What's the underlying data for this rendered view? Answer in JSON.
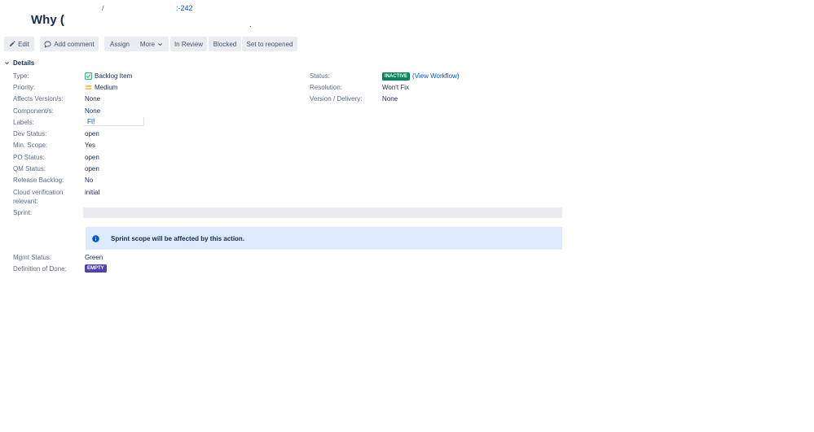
{
  "breadcrumb": {
    "separator": "/",
    "issue_key": ":-242"
  },
  "issue": {
    "title": "Why (",
    "title_tail": "."
  },
  "toolbar": {
    "edit": "Edit",
    "add_comment": "Add comment",
    "assign": "Assign",
    "more": "More",
    "in_review": "In Review",
    "blocked": "Blocked",
    "set_to_reopened": "Set to reopened"
  },
  "details": {
    "heading": "Details",
    "left": {
      "type": {
        "label": "Type:",
        "value": "Backlog Item"
      },
      "priority": {
        "label": "Priority:",
        "value": "Medium"
      },
      "affects_version": {
        "label": "Affects Version/s:",
        "value": "None"
      },
      "components": {
        "label": "Component/s:",
        "value": "None"
      },
      "labels": {
        "label": "Labels:",
        "value": "FI",
        "cursor": "!"
      },
      "dev_status": {
        "label": "Dev Status:",
        "value": "open"
      },
      "min_scope": {
        "label": "Min. Scope:",
        "value": "Yes"
      },
      "po_status": {
        "label": "PO Status:",
        "value": "open"
      },
      "qm_status": {
        "label": "QM Status:",
        "value": "open"
      },
      "release_backlog": {
        "label": "Release Backlog:",
        "value": "No"
      },
      "cloud_verification": {
        "label_line1": "Cloud verification",
        "label_line2": "relevant:",
        "value": "initial"
      },
      "sprint": {
        "label": "Sprint:"
      },
      "sprint_notice": "Sprint scope will be affected by this action.",
      "mgmt_status": {
        "label": "Mgmt Status:",
        "value": "Green"
      },
      "definition_of_done": {
        "label": "Definition of Done:",
        "value": "EMPTY"
      }
    },
    "right": {
      "status": {
        "label": "Status:",
        "value": "INACTIVE",
        "workflow_link": "View Workflow",
        "open_paren": "(",
        "close_paren": ")"
      },
      "resolution": {
        "label": "Resolution:",
        "value": "Won't Fix"
      },
      "version_delivery": {
        "label": "Version / Delivery:",
        "value": "None"
      }
    }
  },
  "colors": {
    "link": "#0052cc",
    "status_lozenge": "#00875a",
    "empty_lozenge": "#5243aa",
    "info_banner": "#deebff",
    "button_bg": "#ebecf0",
    "priority_medium": "#ffab00",
    "type_icon": "#36b37e"
  },
  "icons": {
    "edit": "pencil-icon",
    "comment": "comment-icon",
    "more": "chevron-down-icon",
    "details_toggle": "chevron-down-icon",
    "type": "backlog-item-checkbox-icon",
    "priority": "priority-medium-icon",
    "info": "info-icon"
  }
}
